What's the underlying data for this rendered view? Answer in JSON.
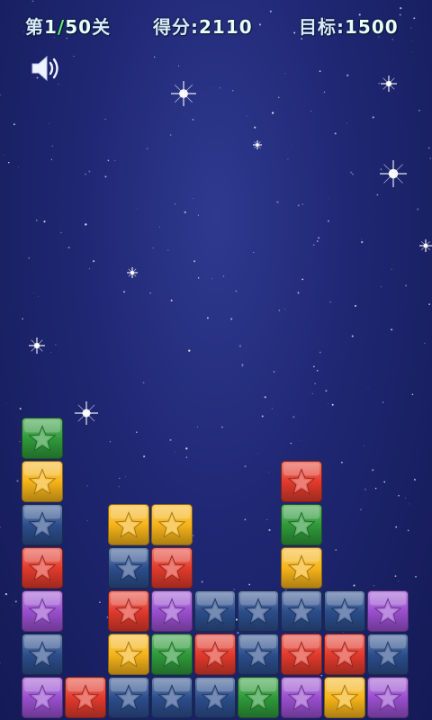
{
  "hud": {
    "level_prefix": "第",
    "level_current": "1",
    "level_separator": "/",
    "level_total": "50",
    "level_suffix": "关",
    "score_label": "得分:",
    "score_value": "2110",
    "target_label": "目标:",
    "target_value": "1500"
  },
  "sound": {
    "icon": "speaker-icon",
    "state": "on"
  },
  "colors": {
    "green": "#2f9a3a",
    "yellow": "#f6b41a",
    "blue": "#2c4e8c",
    "red": "#e23a2c",
    "purple": "#9a4fcf"
  },
  "board": {
    "columns": 10,
    "rows": 7,
    "grid_top_to_bottom": [
      [
        "green",
        null,
        null,
        null,
        null,
        null,
        null,
        null,
        null,
        null
      ],
      [
        "yellow",
        null,
        null,
        null,
        null,
        null,
        "red",
        null,
        null,
        null
      ],
      [
        "blue",
        null,
        "yellow",
        "yellow",
        null,
        null,
        "green",
        null,
        null,
        null
      ],
      [
        "red",
        null,
        "blue",
        "red",
        null,
        null,
        "yellow",
        null,
        null,
        null
      ],
      [
        "purple",
        null,
        "red",
        "purple",
        "blue",
        "blue",
        "blue",
        "blue",
        "purple",
        null
      ],
      [
        "blue",
        null,
        "yellow",
        "green",
        "red",
        "blue",
        "red",
        "red",
        "blue",
        null
      ],
      [
        "purple",
        "red",
        "blue",
        "blue",
        "blue",
        "green",
        "purple",
        "yellow",
        "purple",
        null
      ]
    ]
  }
}
